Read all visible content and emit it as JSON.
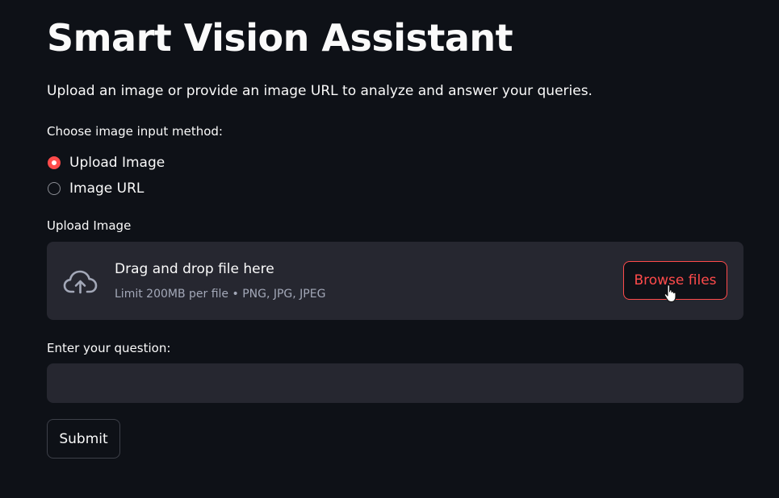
{
  "page": {
    "title": "Smart Vision Assistant",
    "subtitle": "Upload an image or provide an image URL to analyze and answer your queries."
  },
  "input_method": {
    "label": "Choose image input method:",
    "options": [
      {
        "label": "Upload Image",
        "selected": true
      },
      {
        "label": "Image URL",
        "selected": false
      }
    ]
  },
  "uploader": {
    "label": "Upload Image",
    "icon": "cloud-upload-icon",
    "primary_text": "Drag and drop file here",
    "secondary_text": "Limit 200MB per file • PNG, JPG, JPEG",
    "browse_label": "Browse files"
  },
  "question": {
    "label": "Enter your question:",
    "value": "",
    "placeholder": ""
  },
  "submit": {
    "label": "Submit"
  },
  "colors": {
    "background": "#0e1117",
    "surface": "#262730",
    "accent": "#ff4b4b",
    "text": "#fafafa",
    "muted_text": "#a3a8b8"
  }
}
